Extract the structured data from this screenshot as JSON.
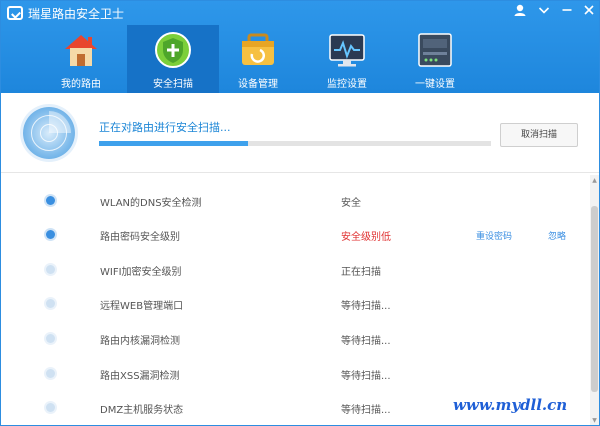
{
  "app": {
    "title": "瑞星路由安全卫士"
  },
  "window_controls": {
    "user_icon": "user-icon",
    "menu_icon": "chevron-down-icon",
    "min_icon": "minimize-icon",
    "close_icon": "close-icon"
  },
  "nav": {
    "items": [
      {
        "label": "我的路由",
        "icon": "house-icon",
        "active": false
      },
      {
        "label": "安全扫描",
        "icon": "shield-icon",
        "active": true
      },
      {
        "label": "设备管理",
        "icon": "toolbox-icon",
        "active": false
      },
      {
        "label": "监控设置",
        "icon": "monitor-icon",
        "active": false
      },
      {
        "label": "一键设置",
        "icon": "router-icon",
        "active": false
      }
    ]
  },
  "scan": {
    "status_text": "正在对路由进行安全扫描...",
    "progress_fraction": 0.38,
    "cancel_label": "取消扫描"
  },
  "checks": [
    {
      "name": "WLAN的DNS安全检测",
      "status": "安全",
      "state": "done",
      "warn": false
    },
    {
      "name": "路由密码安全级别",
      "status": "安全级别低",
      "state": "done",
      "warn": true,
      "actions": [
        "重设密码",
        "忽略"
      ]
    },
    {
      "name": "WIFI加密安全级别",
      "status": "正在扫描",
      "state": "pending",
      "warn": false
    },
    {
      "name": "远程WEB管理端口",
      "status": "等待扫描...",
      "state": "pending",
      "warn": false
    },
    {
      "name": "路由内核漏洞检测",
      "status": "等待扫描...",
      "state": "pending",
      "warn": false
    },
    {
      "name": "路由XSS漏洞检测",
      "status": "等待扫描...",
      "state": "pending",
      "warn": false
    },
    {
      "name": "DMZ主机服务状态",
      "status": "等待扫描...",
      "state": "pending",
      "warn": false
    }
  ],
  "watermark": "www.mydll.cn",
  "colors": {
    "header_blue": "#2e97ea",
    "active_tab": "#1672c7",
    "warn_red": "#e03131",
    "link_blue": "#3b8fe2"
  }
}
